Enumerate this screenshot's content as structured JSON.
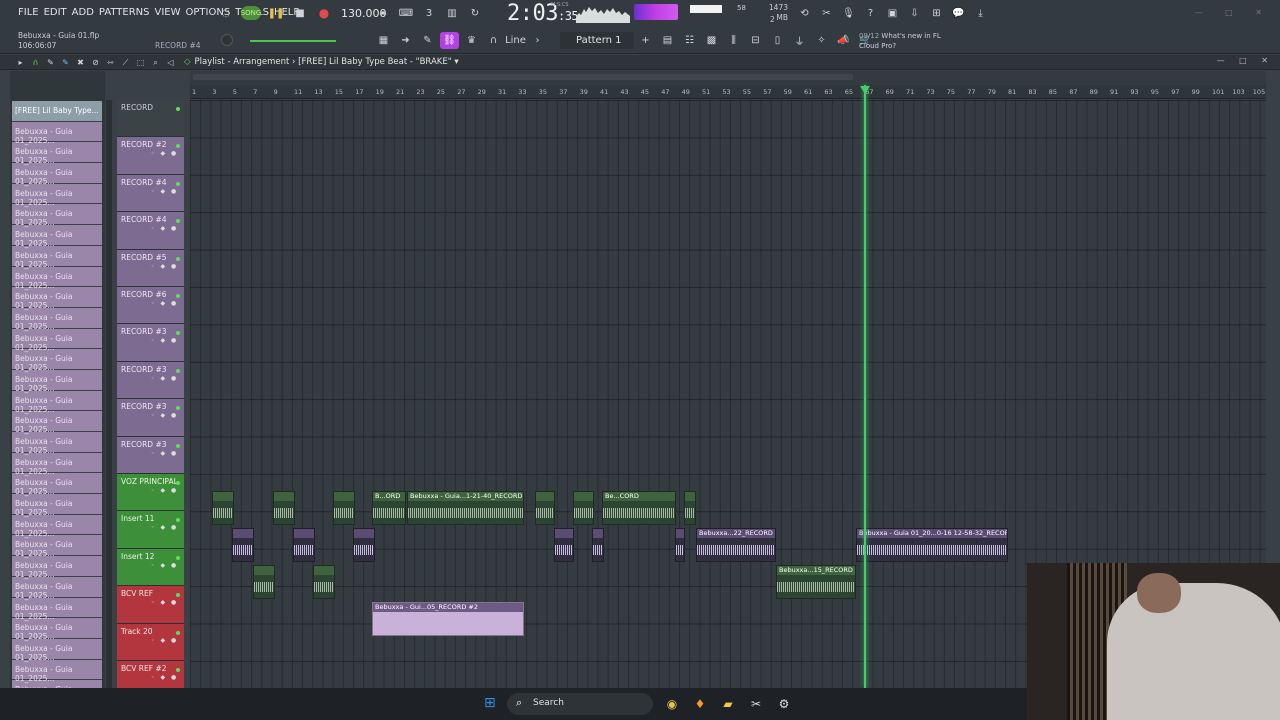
{
  "menu": [
    "FILE",
    "EDIT",
    "ADD",
    "PATTERNS",
    "VIEW",
    "OPTIONS",
    "TOOLS",
    "HELP"
  ],
  "project": {
    "filename": "Bebuxxa - Guia 01.flp",
    "elapsed": "106:06:07",
    "record_hint": "RECORD #4"
  },
  "transport": {
    "song_label": "SONG",
    "tempo": "130.000"
  },
  "time": {
    "main": "2:03",
    "sub": ":35",
    "tag": "M:S:CS"
  },
  "cpu": "58",
  "ram": {
    "value": "1473 MB",
    "polyphony": "2"
  },
  "snap": "Line",
  "pattern": "Pattern 1",
  "news": {
    "count": "09/12",
    "line1": "What's new in FL",
    "line2": "Cloud Pro?"
  },
  "playlist": {
    "title_prefix": "Playlist - Arrangement",
    "title_sep": "›",
    "title_name": "[FREE] Lil Baby Type Beat - \"BRAKE\"",
    "ruler": [
      "1",
      "3",
      "5",
      "7",
      "9",
      "11",
      "13",
      "15",
      "17",
      "19",
      "21",
      "23",
      "25",
      "27",
      "29",
      "31",
      "33",
      "35",
      "37",
      "39",
      "41",
      "43",
      "45",
      "47",
      "49",
      "51",
      "53",
      "55",
      "57",
      "59",
      "61",
      "63",
      "65",
      "67",
      "69",
      "71",
      "73",
      "75",
      "77",
      "79",
      "81",
      "83",
      "85",
      "87",
      "89",
      "91",
      "93",
      "95",
      "97",
      "99",
      "101",
      "103",
      "105"
    ]
  },
  "picker": {
    "first": "[FREE] Lil Baby Type...",
    "items": [
      "Bebuxxa - Guia 01_2025...",
      "Bebuxxa - Guia 01_2025...",
      "Bebuxxa - Guia 01_2025...",
      "Bebuxxa - Guia 01_2025...",
      "Bebuxxa - Guia 01_2025...",
      "Bebuxxa - Guia 01_2025...",
      "Bebuxxa - Guia 01_2025...",
      "Bebuxxa - Guia 01_2025...",
      "Bebuxxa - Guia 01_2025...",
      "Bebuxxa - Guia 01_2025...",
      "Bebuxxa - Guia 01_2025...",
      "Bebuxxa - Guia 01_2025...",
      "Bebuxxa - Guia 01_2025...",
      "Bebuxxa - Guia 01_2025...",
      "Bebuxxa - Guia 01_2025...",
      "Bebuxxa - Guia 01_2025...",
      "Bebuxxa - Guia 01_2025...",
      "Bebuxxa - Guia 01_2025...",
      "Bebuxxa - Guia 01_2025...",
      "Bebuxxa - Guia 01_2025...",
      "Bebuxxa - Guia 01_2025...",
      "Bebuxxa - Guia 01_2025...",
      "Bebuxxa - Guia 01_2025...",
      "Bebuxxa - Guia 01_2025...",
      "Bebuxxa - Guia 01_2025...",
      "Bebuxxa - Guia 01_2025...",
      "Bebuxxa - Guia 01_2025...",
      "Bebuxxa - Guia 01_2025..."
    ]
  },
  "tracks": [
    {
      "name": "RECORD",
      "style": "plain"
    },
    {
      "name": "RECORD #2",
      "style": "violet"
    },
    {
      "name": "RECORD #4",
      "style": "violet"
    },
    {
      "name": "RECORD #4",
      "style": "violet"
    },
    {
      "name": "RECORD #5",
      "style": "violet"
    },
    {
      "name": "RECORD #6",
      "style": "violet"
    },
    {
      "name": "RECORD #3",
      "style": "violet"
    },
    {
      "name": "RECORD #3",
      "style": "violet"
    },
    {
      "name": "RECORD #3",
      "style": "violet"
    },
    {
      "name": "RECORD #3",
      "style": "violet"
    },
    {
      "name": "VOZ PRINCIPAL",
      "style": "green"
    },
    {
      "name": "Insert 11",
      "style": "green"
    },
    {
      "name": "Insert 12",
      "style": "green"
    },
    {
      "name": "BCV REF",
      "style": "red"
    },
    {
      "name": "Track 20",
      "style": "red"
    },
    {
      "name": "BCV REF #2",
      "style": "red"
    }
  ],
  "clips": {
    "c1": "B...ORD",
    "c2": "Bebuxxa - Guia...1-21-40_RECORD",
    "c3": "Be...CORD",
    "c4": "Bebuxxa...22_RECORD",
    "c5": "Bebuxxa - Guia 01_20...0-16 12-58-32_RECORD",
    "c6": "Bebuxxa...15_RECORD",
    "c7": "Bebuxxa - Gui...05_RECORD #2"
  },
  "taskbar": {
    "search": "Search"
  }
}
